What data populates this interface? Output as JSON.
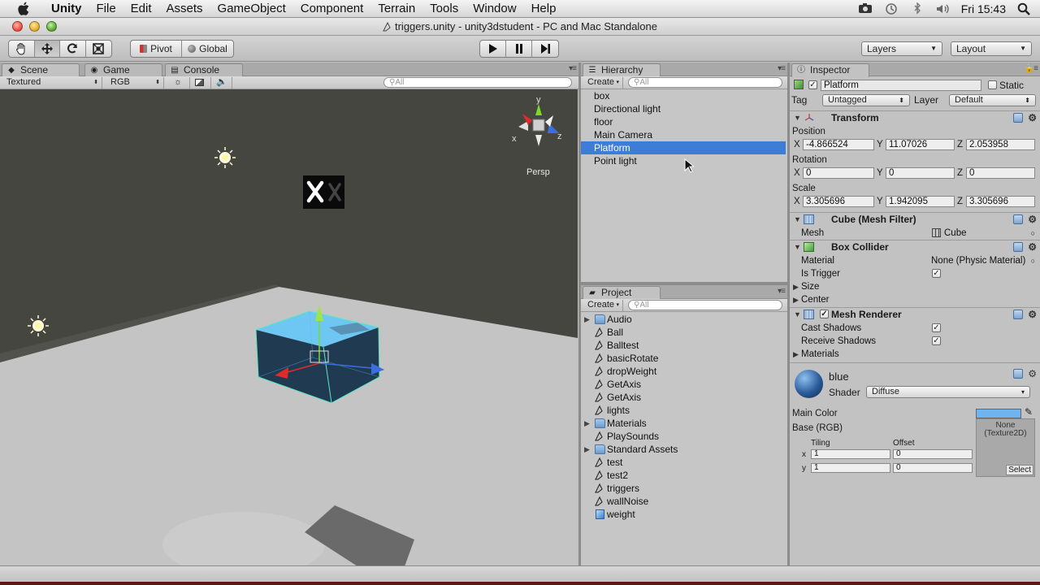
{
  "menubar": {
    "app_name": "Unity",
    "items": [
      "File",
      "Edit",
      "Assets",
      "GameObject",
      "Component",
      "Terrain",
      "Tools",
      "Window",
      "Help"
    ],
    "clock": "Fri 15:43",
    "status_icons": [
      "camera-icon",
      "time-machine-icon",
      "bluetooth-icon",
      "volume-icon",
      "search-icon"
    ]
  },
  "window": {
    "title": "triggers.unity - unity3dstudent - PC and Mac Standalone"
  },
  "toolbar": {
    "pivot_label": "Pivot",
    "global_label": "Global",
    "layers_label": "Layers",
    "layout_label": "Layout"
  },
  "scene_pane": {
    "tabs": [
      "Scene",
      "Game",
      "Console"
    ],
    "render_mode": "Textured",
    "color_mode": "RGB",
    "search_placeholder": "All",
    "gizmo_label": "Persp",
    "gizmo_axes": {
      "y": "y",
      "x": "x",
      "z": "z"
    }
  },
  "hierarchy": {
    "tab": "Hierarchy",
    "create_label": "Create",
    "search_placeholder": "All",
    "items": [
      "box",
      "Directional light",
      "floor",
      "Main Camera",
      "Platform",
      "Point light"
    ],
    "selected": "Platform"
  },
  "project": {
    "tab": "Project",
    "create_label": "Create",
    "search_placeholder": "All",
    "items": [
      {
        "name": "Audio",
        "type": "folder",
        "expandable": true
      },
      {
        "name": "Ball",
        "type": "script"
      },
      {
        "name": "Balltest",
        "type": "script"
      },
      {
        "name": "basicRotate",
        "type": "script"
      },
      {
        "name": "dropWeight",
        "type": "script"
      },
      {
        "name": "GetAxis",
        "type": "script"
      },
      {
        "name": "GetAxis",
        "type": "script"
      },
      {
        "name": "lights",
        "type": "script"
      },
      {
        "name": "Materials",
        "type": "folder",
        "expandable": true
      },
      {
        "name": "PlaySounds",
        "type": "script"
      },
      {
        "name": "Standard Assets",
        "type": "folder",
        "expandable": true
      },
      {
        "name": "test",
        "type": "script"
      },
      {
        "name": "test2",
        "type": "script"
      },
      {
        "name": "triggers",
        "type": "script"
      },
      {
        "name": "wallNoise",
        "type": "script"
      },
      {
        "name": "weight",
        "type": "prefab"
      }
    ]
  },
  "inspector": {
    "tab": "Inspector",
    "object_name": "Platform",
    "static_label": "Static",
    "tag_label": "Tag",
    "tag_value": "Untagged",
    "layer_label": "Layer",
    "layer_value": "Default",
    "transform": {
      "title": "Transform",
      "position_label": "Position",
      "rotation_label": "Rotation",
      "scale_label": "Scale",
      "axis_x": "X",
      "axis_y": "Y",
      "axis_z": "Z",
      "position": {
        "x": "-4.866524",
        "y": "11.07026",
        "z": "2.053958"
      },
      "rotation": {
        "x": "0",
        "y": "0",
        "z": "0"
      },
      "scale": {
        "x": "3.305696",
        "y": "1.942095",
        "z": "3.305696"
      }
    },
    "mesh_filter": {
      "title": "Cube (Mesh Filter)",
      "mesh_label": "Mesh",
      "mesh_value": "Cube"
    },
    "box_collider": {
      "title": "Box Collider",
      "material_label": "Material",
      "material_value": "None (Physic Material)",
      "is_trigger_label": "Is Trigger",
      "is_trigger": true,
      "size_label": "Size",
      "center_label": "Center"
    },
    "mesh_renderer": {
      "title": "Mesh Renderer",
      "cast_shadows_label": "Cast Shadows",
      "cast_shadows": true,
      "receive_shadows_label": "Receive Shadows",
      "receive_shadows": true,
      "materials_label": "Materials"
    },
    "material": {
      "name": "blue",
      "shader_label": "Shader",
      "shader_value": "Diffuse",
      "main_color_label": "Main Color",
      "main_color": "#6fb3f0",
      "base_label": "Base (RGB)",
      "texture_none": "None",
      "texture_type": "(Texture2D)",
      "select_label": "Select",
      "tiling_label": "Tiling",
      "offset_label": "Offset",
      "tiling_x": "1",
      "tiling_y": "1",
      "offset_x": "0",
      "offset_y": "0",
      "row_x": "x",
      "row_y": "y"
    }
  },
  "colors": {
    "selection": "#3d7dd8",
    "scene_bg": "#464641",
    "floor": "#c4c4c4",
    "cube_top": "#6ec6f2",
    "cube_side": "#203a52"
  }
}
